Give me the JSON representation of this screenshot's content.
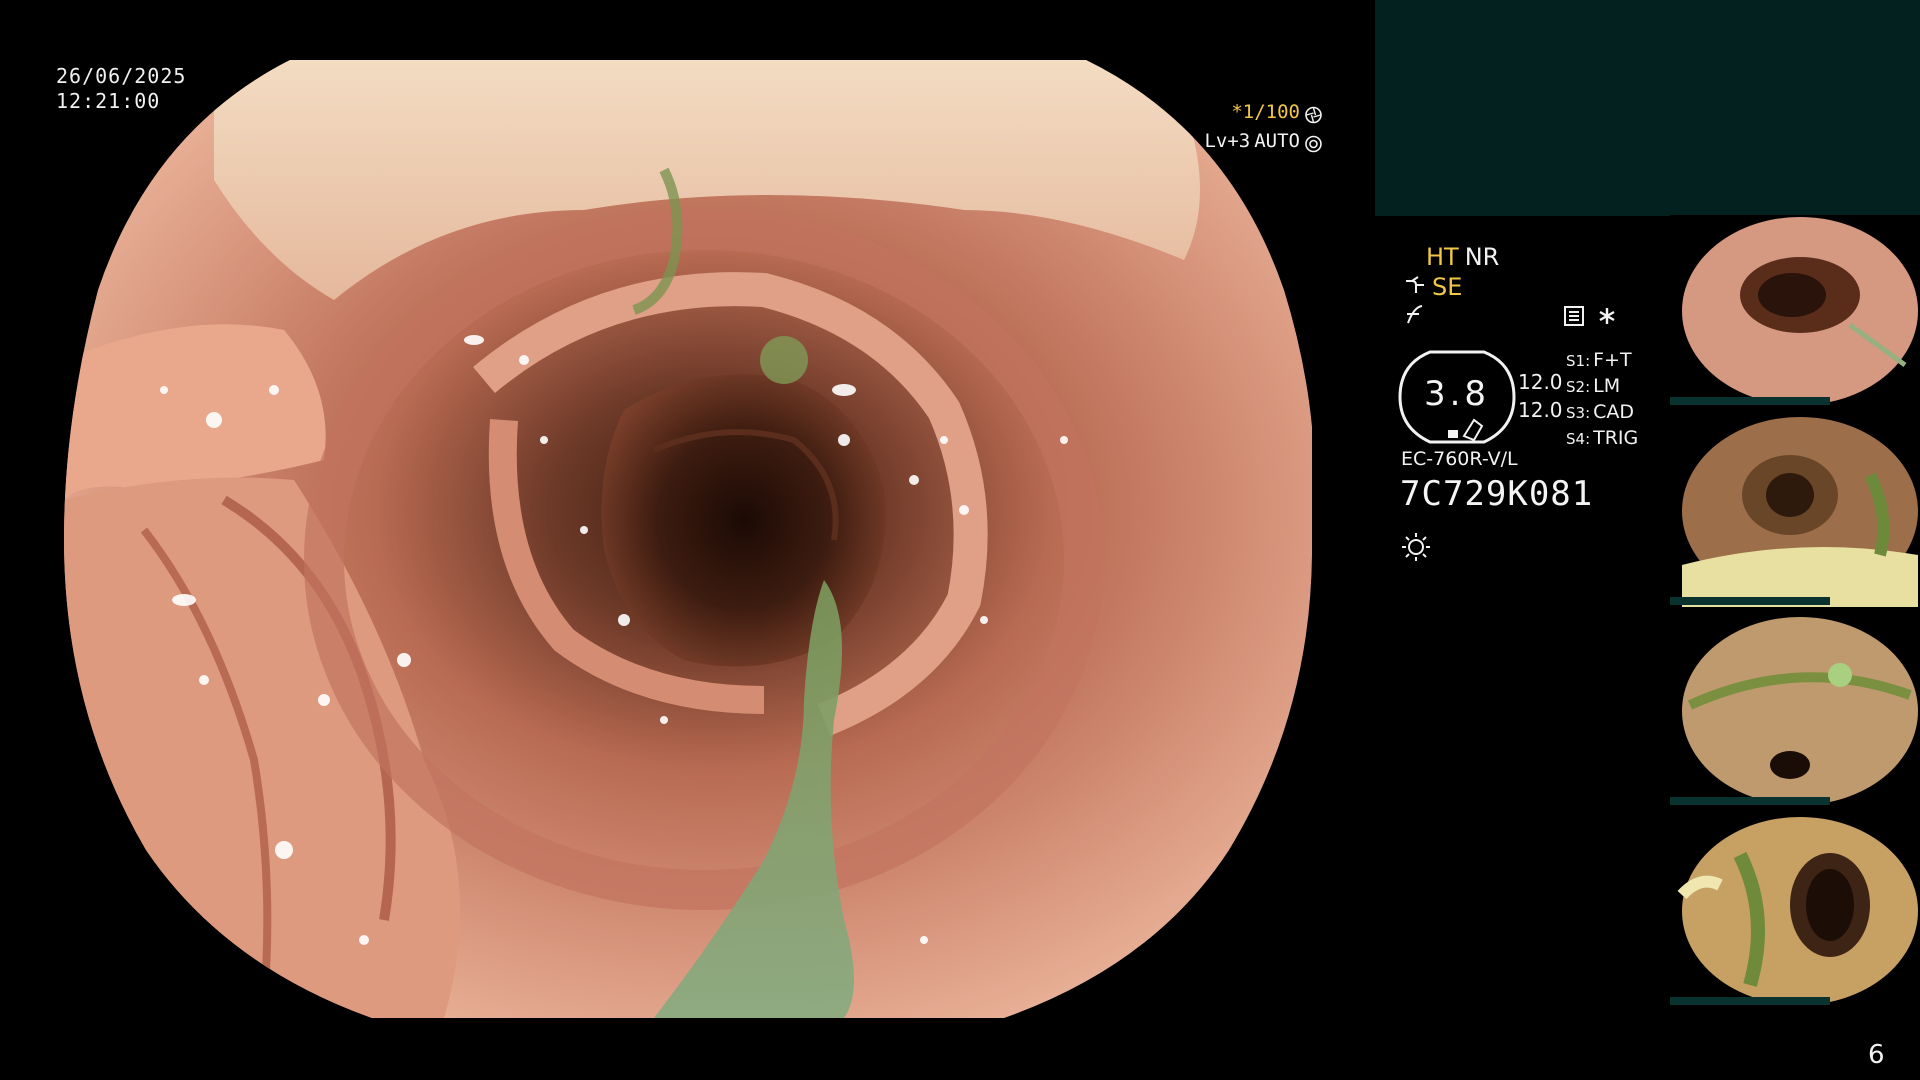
{
  "datetime": {
    "date": "26/06/2025",
    "time": "12:21:00"
  },
  "imaging_overlay": {
    "exposure": "*1/100",
    "level": "Lv+3",
    "mode": "AUTO",
    "icons": [
      "shutter-icon",
      "auto-iris-icon"
    ]
  },
  "modes": {
    "ht": "HT",
    "nr": "NR",
    "se": "SE",
    "icons": [
      "color-enhancement-icon",
      "structure-enhancement-icon",
      "memory-card-icon",
      "asterisk-icon"
    ]
  },
  "gauge": {
    "value": "3.8",
    "secondary_values": [
      "12.0",
      "12.0"
    ]
  },
  "scope_settings": [
    {
      "key": "S1:",
      "value": "F+T"
    },
    {
      "key": "S2:",
      "value": "LM"
    },
    {
      "key": "S3:",
      "value": "CAD"
    },
    {
      "key": "S4:",
      "value": "TRIG"
    }
  ],
  "scope": {
    "model": "EC-760R-V/L",
    "serial": "7C729K081"
  },
  "brightness_icon": "light-source-icon",
  "thumbnails_count": 4,
  "page_number": "6",
  "colors": {
    "background": "#000000",
    "panel": "#02211f",
    "accent_yellow": "#f2c744",
    "mucosa": "#c97a62",
    "lumen": "#2c140c",
    "fluid": "#7f9f6f"
  }
}
